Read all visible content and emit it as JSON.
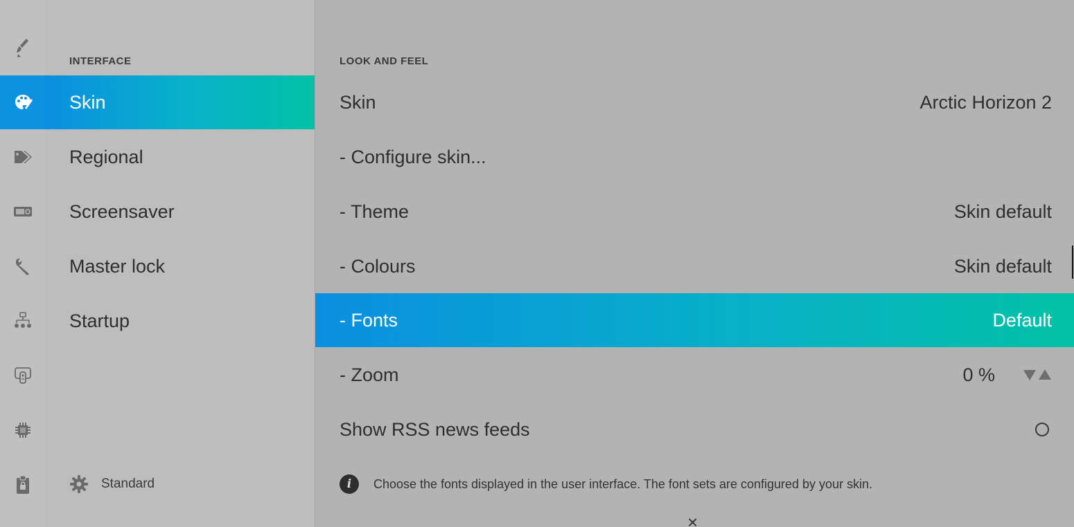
{
  "rail": {
    "icons": [
      "paintbrush-icon",
      "palette-icon",
      "tags-icon",
      "display-clock-icon",
      "wrench-icon",
      "network-icon",
      "remote-icon",
      "chip-icon",
      "clipboard-lock-icon"
    ],
    "active_index": 1,
    "active_color": "#0b93df"
  },
  "categories": {
    "heading": "INTERFACE",
    "items": [
      {
        "label": "Skin"
      },
      {
        "label": "Regional"
      },
      {
        "label": "Screensaver"
      },
      {
        "label": "Master lock"
      },
      {
        "label": "Startup"
      }
    ],
    "active_index": 0,
    "level_label": "Standard"
  },
  "settings": {
    "heading": "LOOK AND FEEL",
    "rows": [
      {
        "label": "Skin",
        "value": "Arctic Horizon 2"
      },
      {
        "label": "- Configure skin...",
        "value": ""
      },
      {
        "label": "- Theme",
        "value": "Skin default"
      },
      {
        "label": "- Colours",
        "value": "Skin default"
      },
      {
        "label": "- Fonts",
        "value": "Default"
      },
      {
        "label": "- Zoom",
        "value": "0 %"
      },
      {
        "label": "Show RSS news feeds",
        "value": ""
      }
    ],
    "focused_index": 4,
    "rss_enabled": false
  },
  "info_text": "Choose the fonts displayed in the user interface. The font sets are configured by your skin.",
  "close_glyph": "×",
  "colors": {
    "accent_start": "#0a8fe0",
    "accent_end": "#03c1a6",
    "background": "#b3b3b3"
  }
}
